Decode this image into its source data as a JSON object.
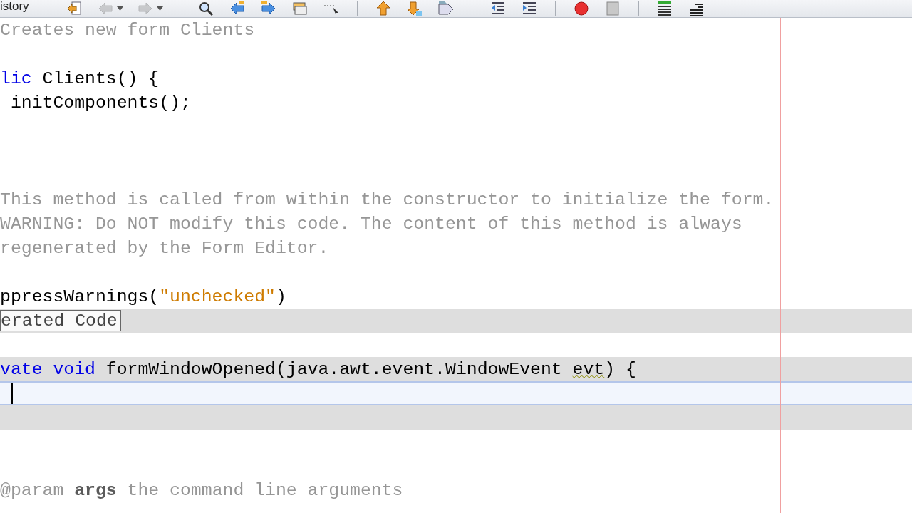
{
  "toolbar": {
    "tab_label": "istory",
    "groups": [
      [
        {
          "kind": "last-edit",
          "disabled": false,
          "dropdown": false
        },
        {
          "kind": "back",
          "disabled": true,
          "dropdown": true
        },
        {
          "kind": "forward",
          "disabled": true,
          "dropdown": true
        }
      ],
      [
        {
          "kind": "find",
          "disabled": false,
          "dropdown": false
        },
        {
          "kind": "find-prev",
          "disabled": false,
          "dropdown": false
        },
        {
          "kind": "find-next",
          "disabled": false,
          "dropdown": false
        },
        {
          "kind": "highlight",
          "disabled": false,
          "dropdown": false
        },
        {
          "kind": "rect-select",
          "disabled": false,
          "dropdown": false
        }
      ],
      [
        {
          "kind": "prev-bookmark",
          "disabled": false,
          "dropdown": false
        },
        {
          "kind": "next-bookmark",
          "disabled": false,
          "dropdown": false
        },
        {
          "kind": "toggle-bookmark",
          "disabled": false,
          "dropdown": false
        }
      ],
      [
        {
          "kind": "shift-left",
          "disabled": false,
          "dropdown": false
        },
        {
          "kind": "shift-right",
          "disabled": false,
          "dropdown": false
        }
      ],
      [
        {
          "kind": "record",
          "disabled": false,
          "dropdown": false
        },
        {
          "kind": "stop",
          "disabled": false,
          "dropdown": false
        }
      ],
      [
        {
          "kind": "check",
          "disabled": false,
          "dropdown": false
        },
        {
          "kind": "lines",
          "disabled": false,
          "dropdown": false
        }
      ]
    ]
  },
  "editor": {
    "lines": [
      {
        "guarded": false,
        "current": false,
        "segments": [
          {
            "kind": "comment",
            "text": "Creates new form Clients"
          }
        ]
      },
      {
        "guarded": false,
        "current": false
      },
      {
        "guarded": false,
        "current": false,
        "segments": [
          {
            "kind": "keyword",
            "text": "lic"
          },
          {
            "kind": "plain",
            "text": " Clients() {"
          }
        ]
      },
      {
        "guarded": false,
        "current": false,
        "segments": [
          {
            "kind": "plain",
            "text": " initComponents();"
          }
        ]
      },
      {
        "guarded": false,
        "current": false
      },
      {
        "guarded": false,
        "current": false
      },
      {
        "guarded": false,
        "current": false
      },
      {
        "guarded": false,
        "current": false,
        "segments": [
          {
            "kind": "comment",
            "text": "This method is called from within the constructor to initialize the form."
          }
        ]
      },
      {
        "guarded": false,
        "current": false,
        "segments": [
          {
            "kind": "comment",
            "text": "WARNING: Do NOT modify this code. The content of this method is always"
          }
        ]
      },
      {
        "guarded": false,
        "current": false,
        "segments": [
          {
            "kind": "comment",
            "text": "regenerated by the Form Editor."
          }
        ]
      },
      {
        "guarded": false,
        "current": false
      },
      {
        "guarded": false,
        "current": false,
        "segments": [
          {
            "kind": "plain",
            "text": "ppressWarnings("
          },
          {
            "kind": "string",
            "text": "\"unchecked\""
          },
          {
            "kind": "plain",
            "text": ")"
          }
        ]
      },
      {
        "guarded": true,
        "current": false,
        "segments": [
          {
            "kind": "fold",
            "text": "erated Code"
          }
        ]
      },
      {
        "guarded": false,
        "current": false
      },
      {
        "guarded": true,
        "current": false,
        "segments": [
          {
            "kind": "keyword",
            "text": "vate void"
          },
          {
            "kind": "plain",
            "text": " formWindowOpened(java.awt.event.WindowEvent "
          },
          {
            "kind": "plain",
            "text": "evt",
            "warning": true
          },
          {
            "kind": "plain",
            "text": ") {"
          }
        ]
      },
      {
        "guarded": false,
        "current": true,
        "caret": true
      },
      {
        "guarded": true,
        "current": false
      },
      {
        "guarded": false,
        "current": false
      },
      {
        "guarded": false,
        "current": false
      },
      {
        "guarded": false,
        "current": false,
        "segments": [
          {
            "kind": "comment",
            "text": "@param "
          },
          {
            "kind": "comment-bold",
            "text": "args"
          },
          {
            "kind": "comment",
            "text": " the command line arguments"
          }
        ]
      }
    ]
  }
}
